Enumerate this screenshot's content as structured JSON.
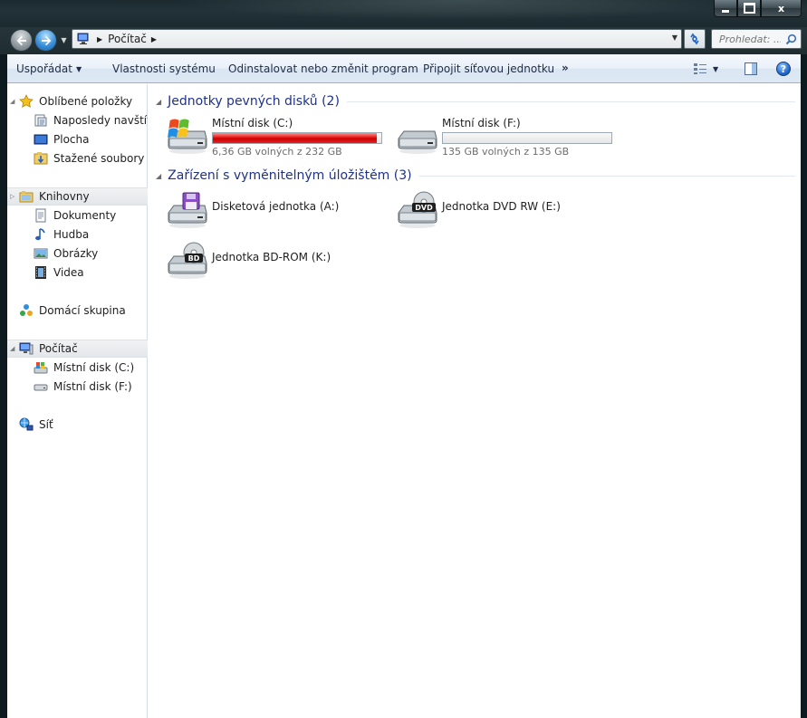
{
  "window": {
    "controls": {
      "minimize": "",
      "maximize": "",
      "close": "x"
    }
  },
  "address_bar": {
    "path": "Počítač",
    "search_placeholder": "Prohledat: ..."
  },
  "command_bar": {
    "organize": "Uspořádat",
    "system_properties": "Vlastnosti systému",
    "uninstall": "Odinstalovat nebo změnit program",
    "map_drive": "Připojit síťovou jednotku",
    "more": "»",
    "help": "?"
  },
  "nav_pane": {
    "favorites": {
      "label": "Oblíbené položky",
      "items": [
        "Naposledy navštíve",
        "Plocha",
        "Stažené soubory"
      ]
    },
    "libraries": {
      "label": "Knihovny",
      "items": [
        "Dokumenty",
        "Hudba",
        "Obrázky",
        "Videa"
      ]
    },
    "homegroup": {
      "label": "Domácí skupina"
    },
    "computer": {
      "label": "Počítač",
      "items": [
        "Místní disk (C:)",
        "Místní disk (F:)"
      ]
    },
    "network": {
      "label": "Síť"
    }
  },
  "content": {
    "hard_drives": {
      "title": "Jednotky pevných disků (2)",
      "items": [
        {
          "name": "Místní disk (C:)",
          "free": "6,36 GB volných z 232 GB",
          "used_fraction": 0.973
        },
        {
          "name": "Místní disk (F:)",
          "free": "135 GB volných z 135 GB",
          "used_fraction": 0.0
        }
      ]
    },
    "removable": {
      "title": "Zařízení s vyměnitelným úložištěm (3)",
      "items": [
        {
          "name": "Disketová jednotka (A:)"
        },
        {
          "name": "Jednotka DVD RW (E:)",
          "badge": "DVD"
        },
        {
          "name": "Jednotka BD-ROM (K:)",
          "badge": "BD"
        }
      ]
    }
  },
  "colors": {
    "drive_bar_used": "#e01010",
    "group_title": "#1e3287",
    "accent": "#3a8fd8"
  }
}
